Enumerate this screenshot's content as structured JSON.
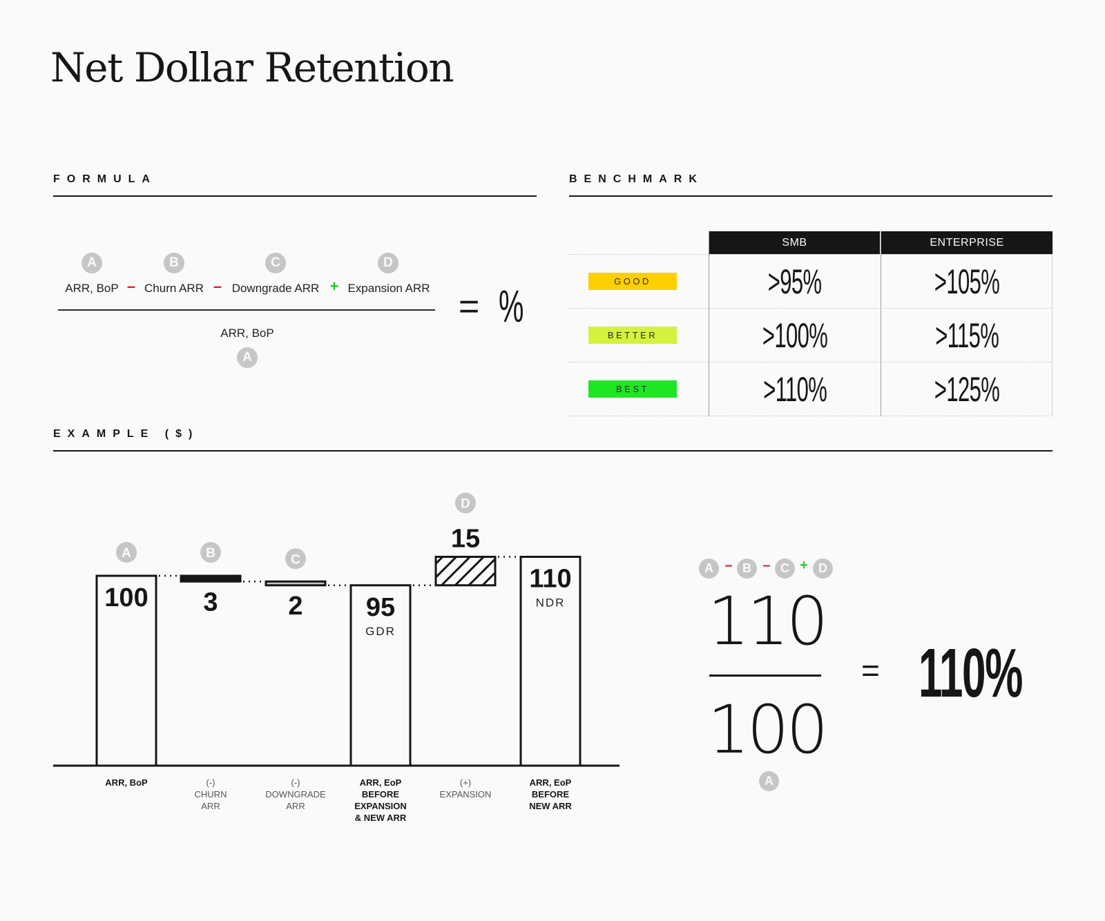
{
  "title": "Net Dollar Retention",
  "sections": {
    "formula": "FORMULA",
    "benchmark": "BENCHMARK",
    "example": "EXAMPLE ($)"
  },
  "formula": {
    "numerator": [
      {
        "badge": "A",
        "label": "ARR, BoP"
      },
      {
        "badge": "B",
        "label": "Churn ARR"
      },
      {
        "badge": "C",
        "label": "Downgrade ARR"
      },
      {
        "badge": "D",
        "label": "Expansion ARR"
      }
    ],
    "operators": [
      "–",
      "–",
      "+"
    ],
    "denominator": {
      "badge": "A",
      "label": "ARR, BoP"
    },
    "equals": "=",
    "result": "%"
  },
  "benchmark": {
    "columns": [
      "SMB",
      "ENTERPRISE"
    ],
    "rows": [
      {
        "tier": "GOOD",
        "color": "#ffcf00",
        "smb": ">95%",
        "enterprise": ">105%"
      },
      {
        "tier": "BETTER",
        "color": "#d4f13e",
        "smb": ">100%",
        "enterprise": ">115%"
      },
      {
        "tier": "BEST",
        "color": "#1ee624",
        "smb": ">110%",
        "enterprise": ">125%"
      }
    ]
  },
  "chart_data": {
    "type": "bar",
    "subtype": "waterfall",
    "title": "EXAMPLE ($)",
    "categories": [
      "ARR, BoP",
      "(-) CHURN ARR",
      "(-) DOWNGRADE ARR",
      "ARR, EoP BEFORE EXPANSION & NEW ARR",
      "(+) EXPANSION",
      "ARR, EoP BEFORE NEW ARR"
    ],
    "category_lines": [
      [
        "ARR, BoP"
      ],
      [
        "(-)",
        "CHURN",
        "ARR"
      ],
      [
        "(-)",
        "DOWNGRADE",
        "ARR"
      ],
      [
        "ARR, EoP",
        "BEFORE",
        "EXPANSION",
        "& NEW ARR"
      ],
      [
        "(+)",
        "EXPANSION"
      ],
      [
        "ARR, EoP",
        "BEFORE",
        "NEW ARR"
      ]
    ],
    "category_bold": [
      true,
      false,
      false,
      true,
      false,
      true
    ],
    "bars": [
      {
        "kind": "total",
        "start": 0,
        "end": 100,
        "value": 100,
        "label": "100",
        "sublabel": "",
        "badge": "A"
      },
      {
        "kind": "decrease",
        "start": 97,
        "end": 100,
        "value": 3,
        "label": "3",
        "sublabel": "",
        "badge": "B"
      },
      {
        "kind": "decrease-light",
        "start": 95,
        "end": 97,
        "value": 2,
        "label": "2",
        "sublabel": "",
        "badge": "C"
      },
      {
        "kind": "total",
        "start": 0,
        "end": 95,
        "value": 95,
        "label": "95",
        "sublabel": "GDR",
        "badge": ""
      },
      {
        "kind": "increase",
        "start": 95,
        "end": 110,
        "value": 15,
        "label": "15",
        "sublabel": "",
        "badge": "D"
      },
      {
        "kind": "total",
        "start": 0,
        "end": 110,
        "value": 110,
        "label": "110",
        "sublabel": "NDR",
        "badge": ""
      }
    ],
    "values": [
      100,
      -3,
      -2,
      95,
      15,
      110
    ],
    "ylim": [
      0,
      110
    ],
    "xlabel": "",
    "ylabel": "",
    "grid": false,
    "legend": "none"
  },
  "result": {
    "badges": [
      "A",
      "B",
      "C",
      "D"
    ],
    "operators": [
      "–",
      "–",
      "+"
    ],
    "numerator": "110",
    "denominator": "100",
    "denominator_badge": "A",
    "equals": "=",
    "value": "110%"
  },
  "colors": {
    "ink": "#161616",
    "badge": "#c6c6c6",
    "minus": "#e8141b",
    "plus": "#1ecb2a",
    "downgrade_fill": "#c4c4c4"
  }
}
